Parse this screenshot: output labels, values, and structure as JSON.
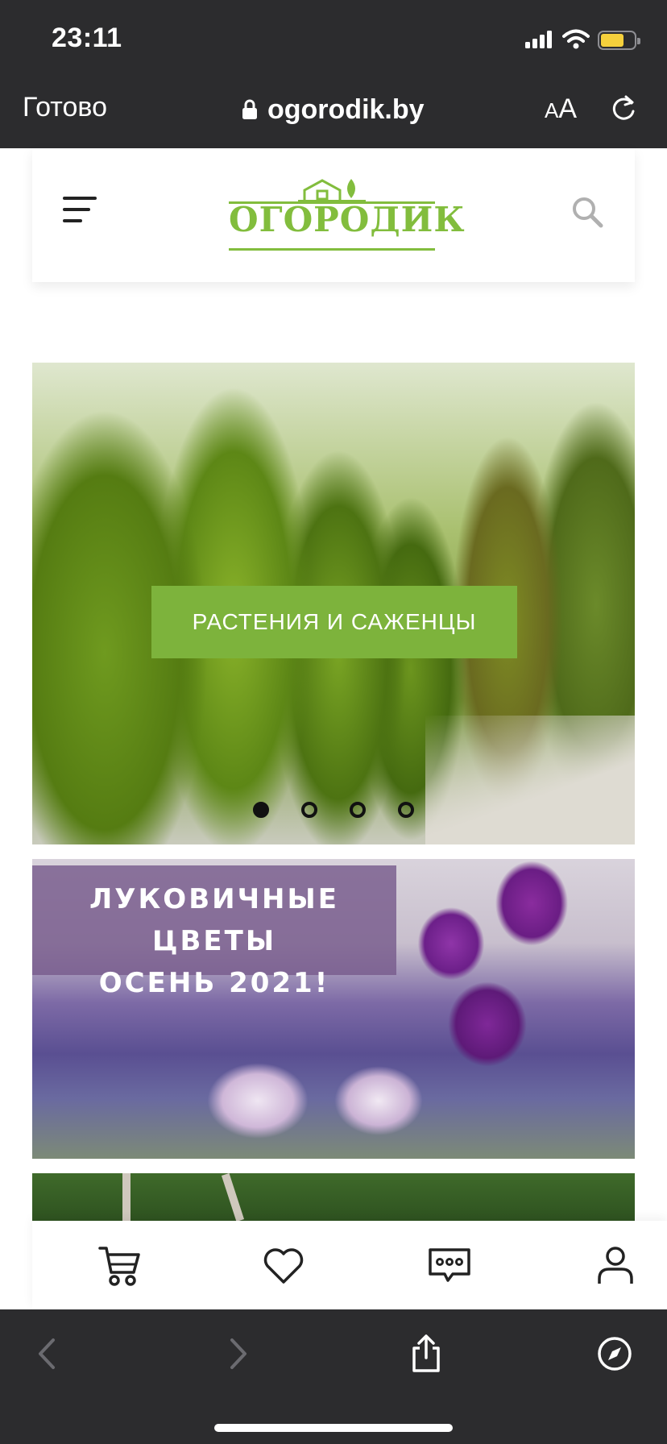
{
  "status_bar": {
    "time": "23:11",
    "icons": [
      "cellular-signal-icon",
      "wifi-icon",
      "battery-icon"
    ],
    "battery_level": 0.6,
    "battery_color": "#f5d03c"
  },
  "browser": {
    "done_label": "Готово",
    "url": "ogorodik.by",
    "text_size_small": "A",
    "text_size_large": "A",
    "chrome_color": "#2c2c2e"
  },
  "site": {
    "logo_text": "ОГОРОДИК",
    "brand_color": "#82bd3d",
    "hero": {
      "cta_label": "РАСТЕНИЯ И САЖЕНЦЫ",
      "cta_color": "#7db33c",
      "slide_count": 4,
      "active_slide": 1
    },
    "promo": {
      "line1": "ЛУКОВИЧНЫЕ ЦВЕТЫ",
      "line2": "ОСЕНЬ 2021!"
    },
    "bottom_nav": [
      "cart-icon",
      "heart-icon",
      "chat-icon",
      "user-icon"
    ]
  },
  "toolbar": {
    "icons": [
      "back-icon",
      "forward-icon",
      "share-icon",
      "compass-icon"
    ]
  }
}
